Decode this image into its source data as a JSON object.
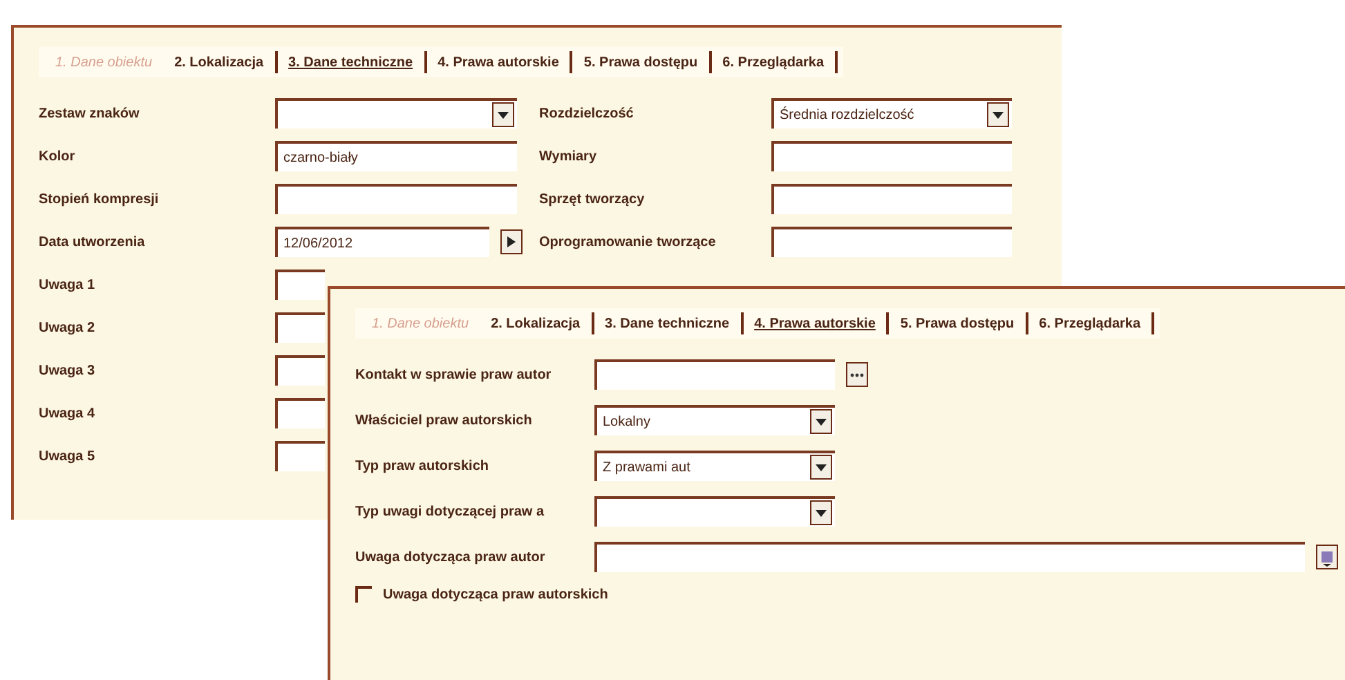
{
  "back_panel": {
    "tabs": [
      {
        "label": "1. Dane obiektu",
        "selected": false,
        "disabled": true
      },
      {
        "label": "2. Lokalizacja",
        "selected": false,
        "disabled": false
      },
      {
        "label": "3. Dane techniczne",
        "selected": true,
        "disabled": false
      },
      {
        "label": "4. Prawa autorskie",
        "selected": false,
        "disabled": false
      },
      {
        "label": "5. Prawa dostępu",
        "selected": false,
        "disabled": false
      },
      {
        "label": "6. Przeglądarka",
        "selected": false,
        "disabled": false
      }
    ],
    "left_fields": [
      {
        "label": "Zestaw znaków",
        "kind": "combo"
      },
      {
        "label": "Kolor",
        "kind": "text",
        "value": "czarno-biały"
      },
      {
        "label": "Stopień kompresji",
        "kind": "text"
      },
      {
        "label": "Data utworzenia",
        "kind": "date",
        "value": "12/06/2012"
      },
      {
        "label": "Uwaga 1",
        "kind": "text"
      },
      {
        "label": "Uwaga 2",
        "kind": "text"
      },
      {
        "label": "Uwaga 3",
        "kind": "text"
      },
      {
        "label": "Uwaga 4",
        "kind": "text"
      },
      {
        "label": "Uwaga 5",
        "kind": "text"
      }
    ],
    "right_fields": [
      {
        "label": "Rozdzielczość",
        "kind": "combo",
        "value": "Średnia rozdzielczość"
      },
      {
        "label": "Wymiary",
        "kind": "text"
      },
      {
        "label": "Sprzęt tworzący",
        "kind": "text"
      },
      {
        "label": "Oprogramowanie tworzące",
        "kind": "text"
      }
    ]
  },
  "front_panel": {
    "tabs": [
      {
        "label": "1. Dane obiektu",
        "selected": false,
        "disabled": true
      },
      {
        "label": "2. Lokalizacja",
        "selected": false,
        "disabled": false
      },
      {
        "label": "3. Dane techniczne",
        "selected": false,
        "disabled": false
      },
      {
        "label": "4. Prawa autorskie",
        "selected": true,
        "disabled": false
      },
      {
        "label": "5. Prawa dostępu",
        "selected": false,
        "disabled": false
      },
      {
        "label": "6. Przeglądarka",
        "selected": false,
        "disabled": false
      }
    ],
    "fields": [
      {
        "label": "Kontakt w sprawie praw autor",
        "kind": "lookup"
      },
      {
        "label": "Właściciel praw autorskich",
        "kind": "combo",
        "value": "Lokalny"
      },
      {
        "label": "Typ praw autorskich",
        "kind": "combo",
        "value": "Z prawami aut"
      },
      {
        "label": "Typ uwagi dotyczącej praw a",
        "kind": "combo"
      },
      {
        "label": "Uwaga dotycząca praw autor",
        "kind": "memo"
      }
    ],
    "checkbox": {
      "label": "Uwaga dotycząca praw autorskich",
      "checked": false
    }
  }
}
